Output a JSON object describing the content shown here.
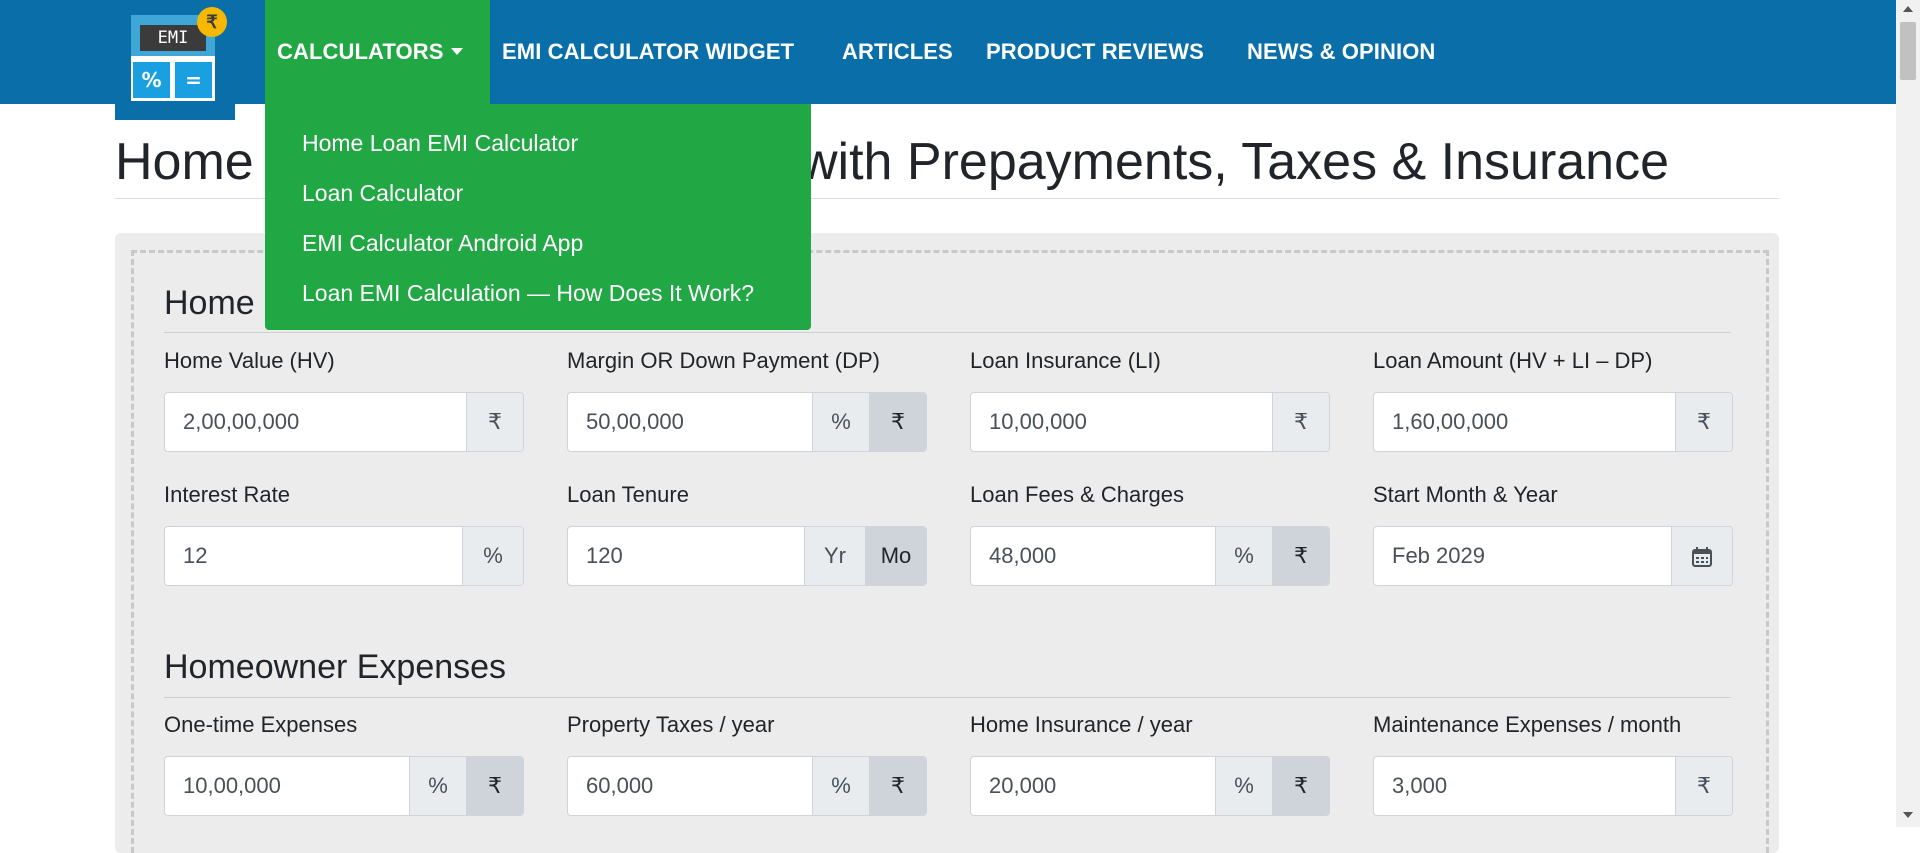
{
  "logo": {
    "display": "EMI",
    "key_left": "%",
    "key_right": "=",
    "badge": "₹"
  },
  "nav": {
    "items": [
      {
        "label": "CALCULATORS"
      },
      {
        "label": "EMI CALCULATOR WIDGET"
      },
      {
        "label": "ARTICLES"
      },
      {
        "label": "PRODUCT REVIEWS"
      },
      {
        "label": "NEWS & OPINION"
      }
    ],
    "dropdown": [
      {
        "label": "Home Loan EMI Calculator"
      },
      {
        "label": "Loan Calculator"
      },
      {
        "label": "EMI Calculator Android App"
      },
      {
        "label": "Loan EMI Calculation — How Does It Work?"
      }
    ]
  },
  "page": {
    "title_left": "Home",
    "title_right": "with Prepayments, Taxes & Insurance"
  },
  "section1": {
    "title": "Home",
    "fields": [
      {
        "label": "Home Value (HV)",
        "value": "2,00,00,000",
        "addons": [
          "₹"
        ]
      },
      {
        "label": "Margin OR Down Payment (DP)",
        "value": "50,00,000",
        "addons": [
          "%",
          "₹"
        ]
      },
      {
        "label": "Loan Insurance (LI)",
        "value": "10,00,000",
        "addons": [
          "₹"
        ]
      },
      {
        "label": "Loan Amount (HV + LI – DP)",
        "value": "1,60,00,000",
        "addons": [
          "₹"
        ]
      },
      {
        "label": "Interest Rate",
        "value": "12",
        "addons": [
          "%"
        ]
      },
      {
        "label": "Loan Tenure",
        "value": "120",
        "addons": [
          "Yr",
          "Mo"
        ]
      },
      {
        "label": "Loan Fees & Charges",
        "value": "48,000",
        "addons": [
          "%",
          "₹"
        ]
      },
      {
        "label": "Start Month & Year",
        "value": "Feb 2029",
        "addons": [
          "calendar-icon"
        ]
      }
    ]
  },
  "section2": {
    "title": "Homeowner Expenses",
    "fields": [
      {
        "label": "One-time Expenses",
        "value": "10,00,000",
        "addons": [
          "%",
          "₹"
        ]
      },
      {
        "label": "Property Taxes / year",
        "value": "60,000",
        "addons": [
          "%",
          "₹"
        ]
      },
      {
        "label": "Home Insurance / year",
        "value": "20,000",
        "addons": [
          "%",
          "₹"
        ]
      },
      {
        "label": "Maintenance Expenses / month",
        "value": "3,000",
        "addons": [
          "₹"
        ]
      }
    ]
  },
  "colors": {
    "navbar": "#0a6fa8",
    "dropdown": "#22a745",
    "card": "#ececec"
  }
}
